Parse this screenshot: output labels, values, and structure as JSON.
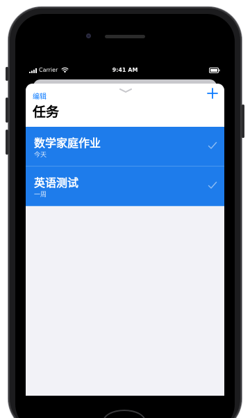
{
  "status_bar": {
    "carrier": "Carrier",
    "time": "9:41 AM",
    "signal_icon": "signal-bars-icon",
    "wifi_icon": "wifi-icon",
    "battery_icon": "battery-icon"
  },
  "header": {
    "edit_label": "编辑",
    "title": "任务",
    "add_icon": "plus-icon",
    "grabber_icon": "chevron-down-icon"
  },
  "tasks": [
    {
      "title": "数学家庭作业",
      "subtitle": "今天",
      "completed": true
    },
    {
      "title": "英语测试",
      "subtitle": "一周",
      "completed": true
    }
  ],
  "colors": {
    "accent": "#0a7aff",
    "row_selected": "#1e7ceb",
    "sheet_background": "#f2f2f7"
  }
}
